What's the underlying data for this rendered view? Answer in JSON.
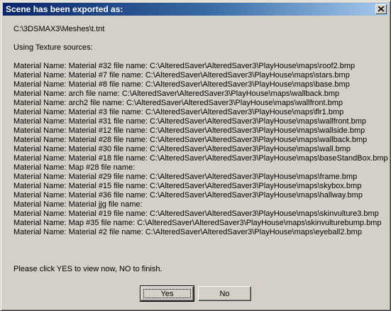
{
  "window": {
    "title": "Scene has been exported as:"
  },
  "message": {
    "file_path": "C:\\3DSMAX3\\Meshes\\t.tnt",
    "sources_heading": "Using Texture sources:",
    "materials": [
      "Material Name: Material #32  file name: C:\\AlteredSaver\\AlteredSaver3\\PlayHouse\\maps\\roof2.bmp",
      "Material Name: Material #7  file name: C:\\AlteredSaver\\AlteredSaver3\\PlayHouse\\maps\\stars.bmp",
      "Material Name: Material #8  file name: C:\\AlteredSaver\\AlteredSaver3\\PlayHouse\\maps\\base.bmp",
      "Material Name: arch  file name: C:\\AlteredSaver\\AlteredSaver3\\PlayHouse\\maps\\wallback.bmp",
      "Material Name: arch2  file name: C:\\AlteredSaver\\AlteredSaver3\\PlayHouse\\maps\\wallfront.bmp",
      "Material Name: Material #3  file name: C:\\AlteredSaver\\AlteredSaver3\\PlayHouse\\maps\\flr1.bmp",
      "Material Name: Material #31  file name: C:\\AlteredSaver\\AlteredSaver3\\PlayHouse\\maps\\wallfront.bmp",
      "Material Name: Material #12  file name: C:\\AlteredSaver\\AlteredSaver3\\PlayHouse\\maps\\wallside.bmp",
      "Material Name: Material #28  file name: C:\\AlteredSaver\\AlteredSaver3\\PlayHouse\\maps\\wallback.bmp",
      "Material Name: Material #30  file name: C:\\AlteredSaver\\AlteredSaver3\\PlayHouse\\maps\\wall.bmp",
      "Material Name: Material #18  file name: C:\\AlteredSaver\\AlteredSaver3\\PlayHouse\\maps\\baseStandBox.bmp",
      "Material Name: Map #28  file name:",
      "Material Name: Material #29  file name: C:\\AlteredSaver\\AlteredSaver3\\PlayHouse\\maps\\frame.bmp",
      "Material Name: Material #15  file name: C:\\AlteredSaver\\AlteredSaver3\\PlayHouse\\maps\\skybox.bmp",
      "Material Name: Material #36  file name: C:\\AlteredSaver\\AlteredSaver3\\PlayHouse\\maps\\hallway.bmp",
      "Material Name: Material jjg  file name:",
      "Material Name: Material #19  file name: C:\\AlteredSaver\\AlteredSaver3\\PlayHouse\\maps\\skinvulture3.bmp",
      "Material Name: Map #35  file name: C:\\AlteredSaver\\AlteredSaver3\\PlayHouse\\maps\\skinvulturebump.bmp",
      "Material Name: Material #2  file name: C:\\AlteredSaver\\AlteredSaver3\\PlayHouse\\maps\\eyeball2.bmp"
    ],
    "prompt": "Please click YES to view now, NO to finish."
  },
  "buttons": {
    "yes_label": "Yes",
    "no_label": "No"
  },
  "icons": {
    "close": "close-icon"
  }
}
